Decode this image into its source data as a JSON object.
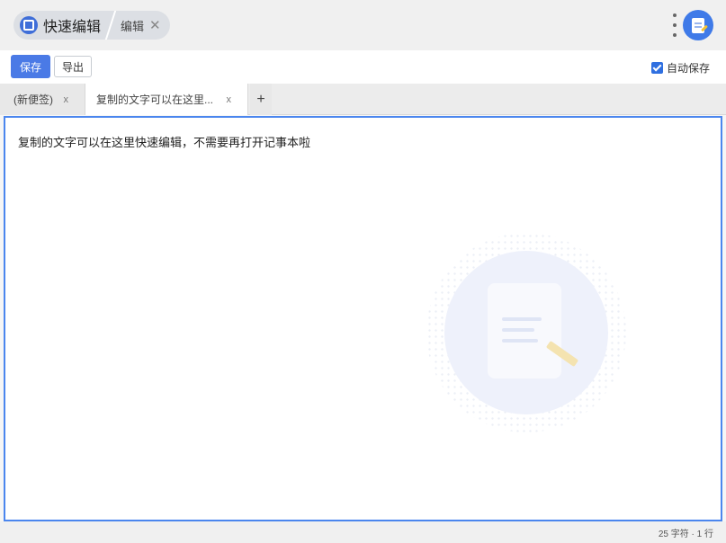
{
  "header": {
    "app_title": "快速编辑",
    "crumb_label": "编辑",
    "crumb_close": "✕"
  },
  "toolbar": {
    "save_label": "保存",
    "export_label": "导出",
    "autosave_label": "自动保存",
    "autosave_checked": true
  },
  "tabs": [
    {
      "label": "(新便签)",
      "close": "x",
      "active": false
    },
    {
      "label": "复制的文字可以在这里...",
      "close": "x",
      "active": true
    }
  ],
  "tab_add_label": "+",
  "editor": {
    "content": "复制的文字可以在这里快速编辑，不需要再打开记事本啦"
  },
  "status": {
    "text": "25 字符 · 1 行"
  },
  "colors": {
    "accent": "#4a7ae6",
    "editor_border": "#4b86ee",
    "avatar": "#3f7ae8"
  }
}
